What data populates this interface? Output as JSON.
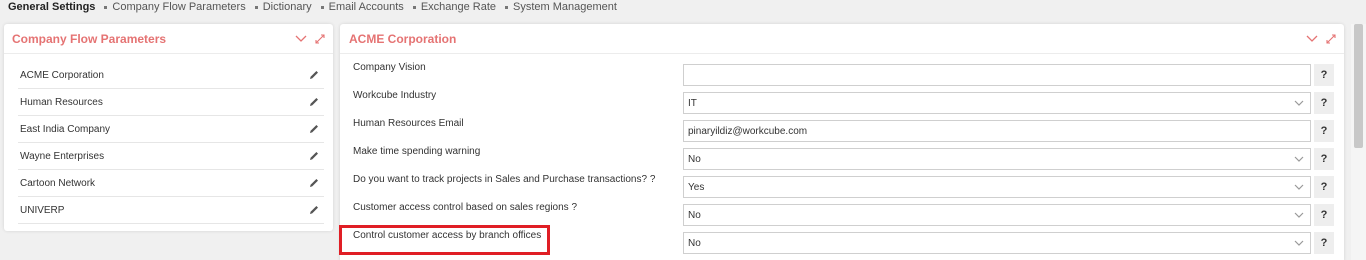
{
  "nav": {
    "items": [
      {
        "label": "General Settings",
        "active": true
      },
      {
        "label": "Company Flow Parameters",
        "active": false
      },
      {
        "label": "Dictionary",
        "active": false
      },
      {
        "label": "Email Accounts",
        "active": false
      },
      {
        "label": "Exchange Rate",
        "active": false
      },
      {
        "label": "System Management",
        "active": false
      }
    ]
  },
  "left_panel": {
    "title": "Company Flow Parameters",
    "companies": [
      "ACME Corporation",
      "Human Resources",
      "East India Company",
      "Wayne Enterprises",
      "Cartoon Network",
      "UNIVERP"
    ]
  },
  "right_panel": {
    "title": "ACME Corporation",
    "help_label": "?",
    "fields": [
      {
        "label": "Company Vision",
        "value": "",
        "type": "text"
      },
      {
        "label": "Workcube Industry",
        "value": "IT",
        "type": "select"
      },
      {
        "label": "Human Resources Email",
        "value": "pinaryildiz@workcube.com",
        "type": "text"
      },
      {
        "label": "Make time spending warning",
        "value": "No",
        "type": "select"
      },
      {
        "label": "Do you want to track projects in Sales and Purchase transactions? ?",
        "value": "Yes",
        "type": "select"
      },
      {
        "label": "Customer access control based on sales regions ?",
        "value": "No",
        "type": "select"
      },
      {
        "label": "Control customer access by branch offices",
        "value": "No",
        "type": "select",
        "highlighted": true
      }
    ]
  },
  "colors": {
    "accent": "#e57373",
    "highlight": "#e01e25"
  }
}
